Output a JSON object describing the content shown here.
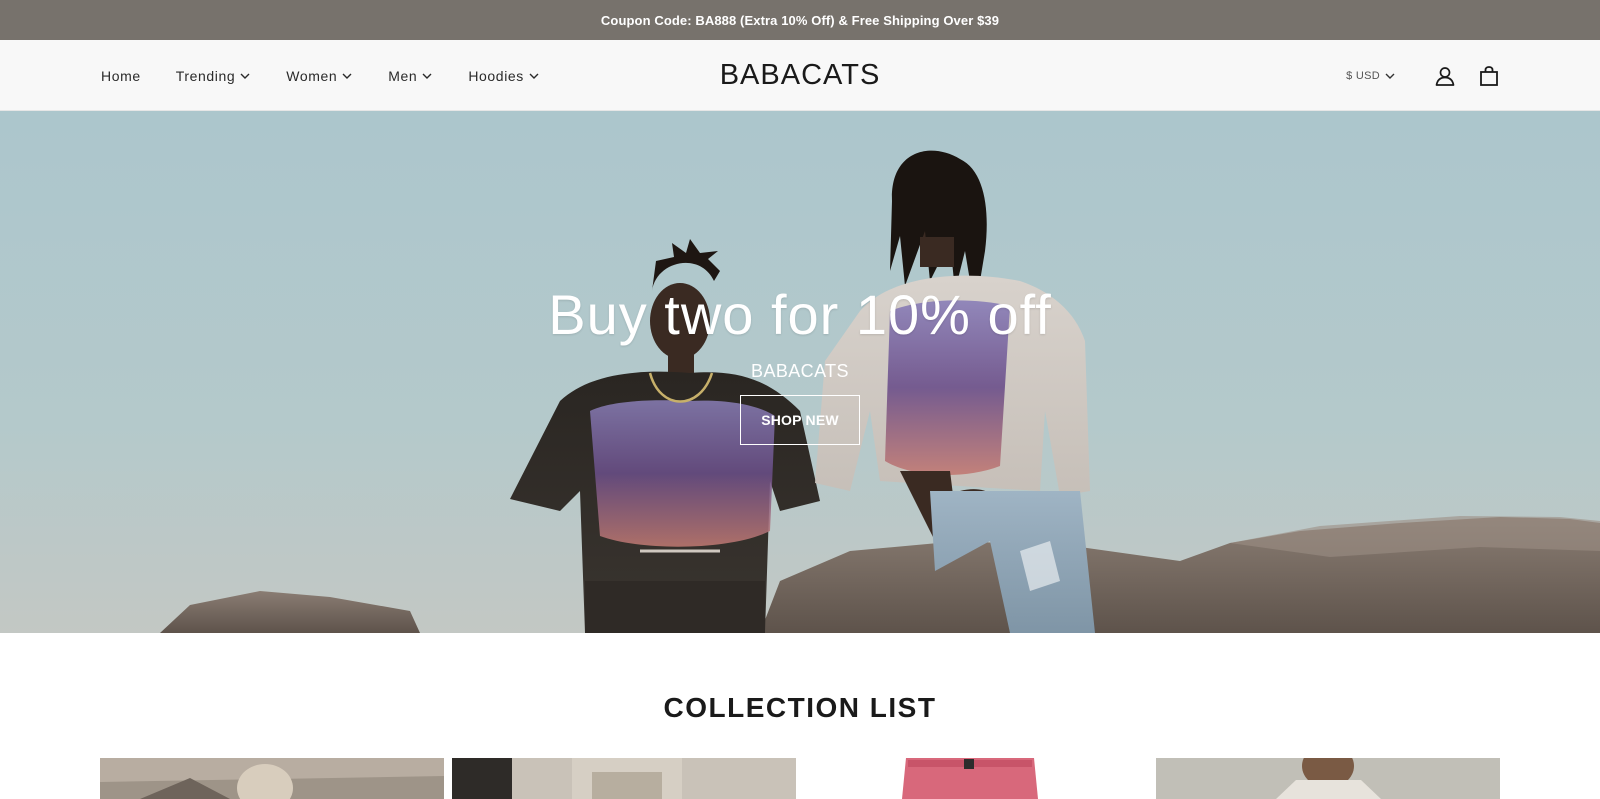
{
  "announcement": {
    "text": "Coupon Code: BA888 (Extra 10% Off) & Free Shipping Over $39",
    "background": "#77726c"
  },
  "header": {
    "logo": "BABACATS",
    "nav": [
      {
        "label": "Home",
        "has_dropdown": false
      },
      {
        "label": "Trending",
        "has_dropdown": true
      },
      {
        "label": "Women",
        "has_dropdown": true
      },
      {
        "label": "Men",
        "has_dropdown": true
      },
      {
        "label": "Hoodies",
        "has_dropdown": true
      }
    ],
    "currency": "$ USD",
    "icons": [
      "chevron-down-icon",
      "account-icon",
      "cart-icon"
    ]
  },
  "hero": {
    "title": "Buy two for 10% off",
    "subtitle": "BABACATS",
    "button_label": "SHOP NEW"
  },
  "collection": {
    "heading": "COLLECTION LIST",
    "cards": [
      {
        "icon": "collection-image-1"
      },
      {
        "icon": "collection-image-2"
      },
      {
        "icon": "collection-image-3"
      },
      {
        "icon": "collection-image-4"
      }
    ]
  }
}
